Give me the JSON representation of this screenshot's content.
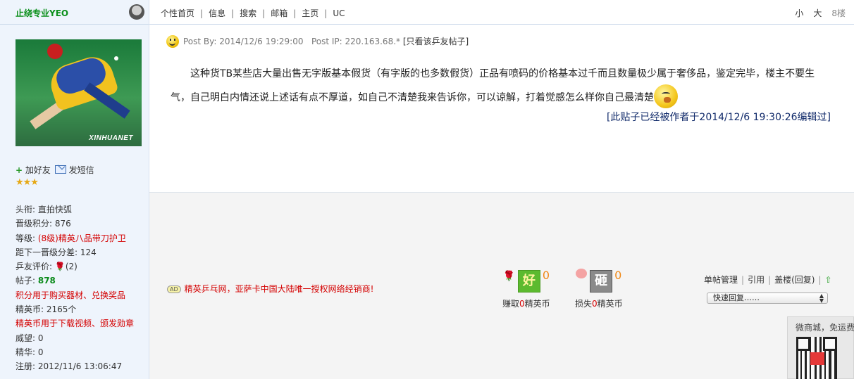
{
  "user": {
    "name": "止绕专业YEO",
    "photo_watermark": "XINHUANET",
    "add_friend": "加好友",
    "send_message": "发短信",
    "stars": "★★★",
    "info": {
      "title": "头衔: 直拍快弧",
      "level_points": "晋级积分: 876",
      "grade_label": "等级: ",
      "grade_value": "(8级)精英八品带刀护卫",
      "to_next": "距下一晋级分差: 124",
      "rating_label": "乒友评价: ",
      "rating_count": "(2)",
      "posts_label": "帖子: ",
      "posts_value": "878",
      "points_note": "积分用于购买器材、兑换奖品",
      "coins": "精英币: 2165个",
      "coins_note": "精英币用于下载视频、颁发勋章",
      "prestige": "威望: 0",
      "essence": "精华: 0",
      "registered": "注册: 2012/11/6 13:06:47"
    }
  },
  "topnav": {
    "links": [
      "个性首页",
      "信息",
      "搜索",
      "邮箱",
      "主页",
      "UC"
    ],
    "font_small": "小",
    "font_large": "大",
    "floor": "8楼"
  },
  "post": {
    "meta_by": "Post By: 2014/12/6 19:29:00",
    "meta_ip": "Post IP: 220.163.68.*",
    "only_this": "[只看该乒友帖子]",
    "body": "这种货TB某些店大量出售无字版基本假货（有字版的也多数假货）正品有喷码的价格基本过千而且数量极少属于奢侈品，鉴定完毕，楼主不要生气，自己明白内情还说上述话有点不厚道，如自己不清楚我来告诉你，可以谅解，打着觉感怎么样你自己最清楚",
    "edit_note": "[此贴子已经被作者于2014/12/6 19:30:26编辑过]"
  },
  "ad": {
    "badge": "AD",
    "text": "精英乒乓网，亚萨卡中国大陆唯一授权网络经销商!"
  },
  "votes": {
    "good": {
      "icon_text": "好",
      "count": "0",
      "label_pre": "赚取",
      "label_zero": "0",
      "label_post": "精英币"
    },
    "bad": {
      "icon_text": "砸",
      "count": "0",
      "label_pre": "损失",
      "label_zero": "0",
      "label_post": "精英币"
    }
  },
  "post_actions": {
    "manage": "单帖管理",
    "quote": "引用",
    "reply_floor": "盖楼(回复)",
    "quick_reply": "快速回复……"
  },
  "wechat": {
    "caption": "微商城，免运费"
  }
}
